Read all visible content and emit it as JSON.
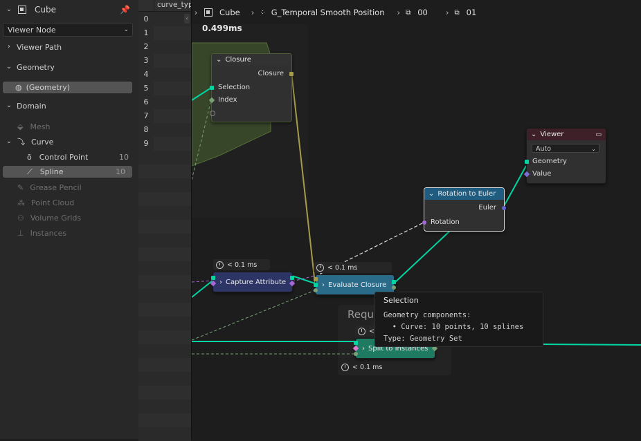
{
  "left_panel": {
    "object_name": "Cube",
    "viewer_select": "Viewer Node",
    "viewer_path_label": "Viewer Path",
    "geometry_label": "Geometry",
    "geometry_item": "(Geometry)",
    "domain_label": "Domain",
    "domains": {
      "mesh": "Mesh",
      "curve": "Curve",
      "control_point": "Control Point",
      "control_point_count": "10",
      "spline": "Spline",
      "spline_count": "10",
      "grease_pencil": "Grease Pencil",
      "point_cloud": "Point Cloud",
      "volume_grids": "Volume Grids",
      "instances": "Instances"
    }
  },
  "spreadsheet": {
    "column_header": "curve_typ",
    "rows": [
      "0",
      "1",
      "2",
      "3",
      "4",
      "5",
      "6",
      "7",
      "8",
      "9"
    ]
  },
  "breadcrumb": {
    "object": "Cube",
    "group": "G_Temporal Smooth Position",
    "zone1": "00",
    "zone2": "01"
  },
  "nodes": {
    "frame_time": "0.499ms",
    "closure": {
      "title": "Closure",
      "out_closure": "Closure",
      "in_selection": "Selection",
      "in_index": "Index"
    },
    "viewer": {
      "title": "Viewer",
      "domain_select": "Auto",
      "in_geometry": "Geometry",
      "in_value": "Value"
    },
    "rotation_to_euler": {
      "title": "Rotation to Euler",
      "out_euler": "Euler",
      "in_rotation": "Rotation"
    },
    "capture_attribute": {
      "title": "Capture Attribute",
      "time": "< 0.1 ms"
    },
    "evaluate_closure": {
      "title": "Evaluate Closure",
      "time": "< 0.1 ms"
    },
    "split_to_instances": {
      "title": "Split to Instances",
      "time": "< 0.1 ms",
      "partial_time": "<"
    },
    "frame_label": "Requ"
  },
  "tooltip": {
    "title": "Selection",
    "line1": "Geometry components:",
    "line2": "  • Curve: 10 points, 10 splines",
    "line3": "Type: Geometry Set"
  },
  "colors": {
    "geometry_link": "#00d6a3",
    "closure_link": "#a59c4a",
    "field_link": "#d0d0d0",
    "rotation_socket": "#a668d6",
    "viewer_header": "#3e2128",
    "rotation_header": "#1f5c80",
    "capture_header": "#2c3566",
    "evaluate_header": "#2b6b8a",
    "split_header": "#1f7a62"
  }
}
